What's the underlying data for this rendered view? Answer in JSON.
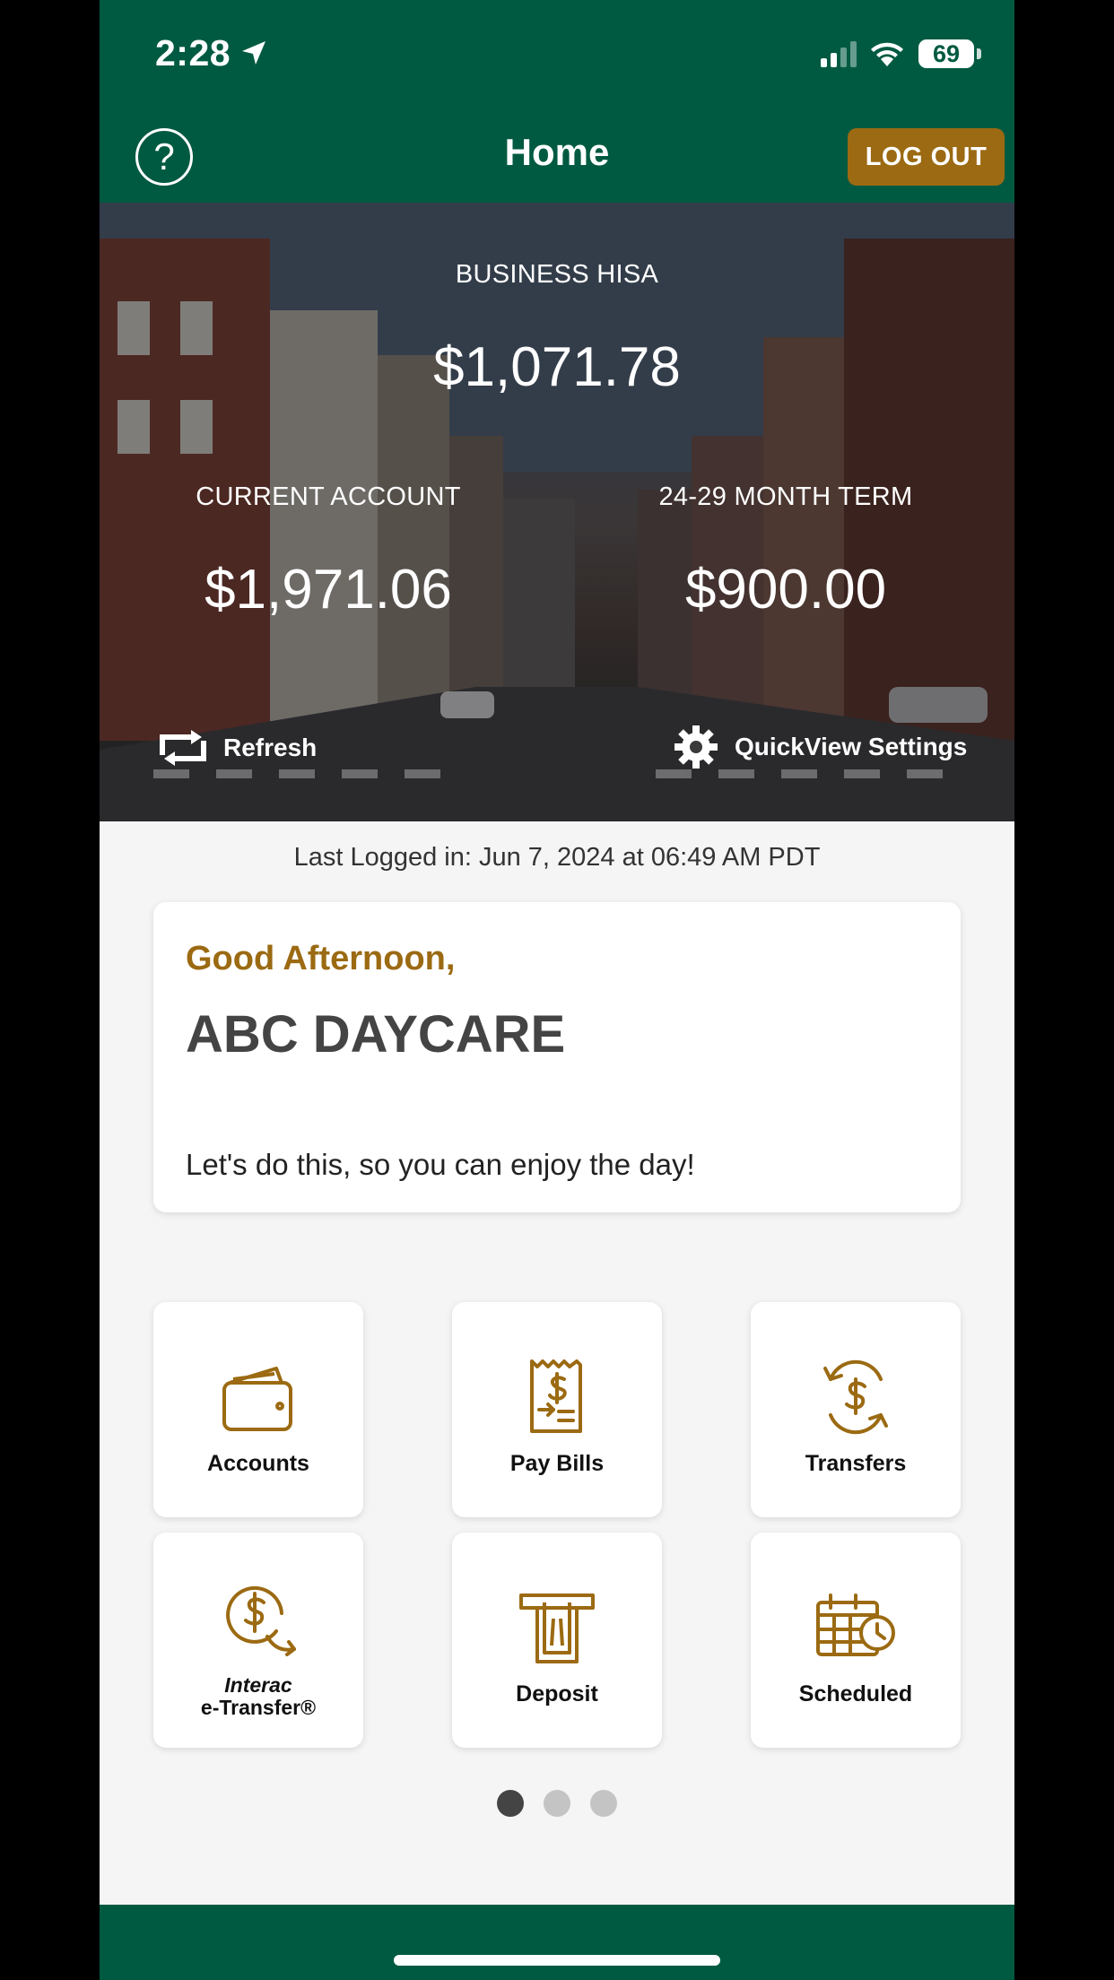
{
  "status_bar": {
    "time": "2:28",
    "battery": "69"
  },
  "header": {
    "title": "Home",
    "help_icon": "?",
    "logout_label": "LOG OUT"
  },
  "quickview": {
    "primary": {
      "label": "BUSINESS HISA",
      "amount": "$1,071.78"
    },
    "left": {
      "label": "CURRENT ACCOUNT",
      "amount": "$1,971.06"
    },
    "right": {
      "label": "24-29 MONTH TERM",
      "amount": "$900.00"
    },
    "refresh_label": "Refresh",
    "settings_label": "QuickView Settings"
  },
  "last_logged": "Last Logged in: Jun 7, 2024 at 06:49 AM  PDT",
  "greeting": {
    "salutation": "Good Afternoon,",
    "name": "ABC DAYCARE",
    "message": "Let's do this, so you can enjoy the day!"
  },
  "tiles": [
    {
      "label": "Accounts",
      "icon": "wallet-icon"
    },
    {
      "label": "Pay Bills",
      "icon": "bill-icon"
    },
    {
      "label": "Transfers",
      "icon": "transfer-icon"
    },
    {
      "label_line1": "Interac",
      "label_line2": "e-Transfer®",
      "icon": "etransfer-icon"
    },
    {
      "label": "Deposit",
      "icon": "deposit-icon"
    },
    {
      "label": "Scheduled",
      "icon": "calendar-icon"
    }
  ],
  "pagination": {
    "pages": 3,
    "current": 1
  },
  "colors": {
    "brand_green": "#005a41",
    "accent_gold": "#9b6a12"
  }
}
